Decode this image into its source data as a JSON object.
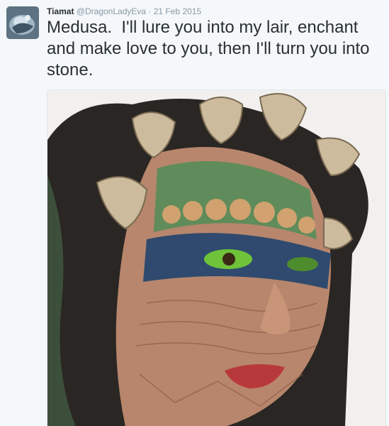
{
  "tweet": {
    "author": {
      "display_name": "Tiamat",
      "handle": "@DragonLadyEva",
      "avatar_icon": "profile-avatar-image"
    },
    "separator": "·",
    "timestamp": "21 Feb 2015",
    "text": "Medusa.  I'll lure you into my lair, enchant and make love to you, then I'll turn you into stone.",
    "media": {
      "type": "photo",
      "icon": "medusa-portrait-photo"
    }
  },
  "colors": {
    "background": "#f5f8fa",
    "text": "#292f33",
    "muted": "#8899a6",
    "border": "#e1e8ed"
  }
}
